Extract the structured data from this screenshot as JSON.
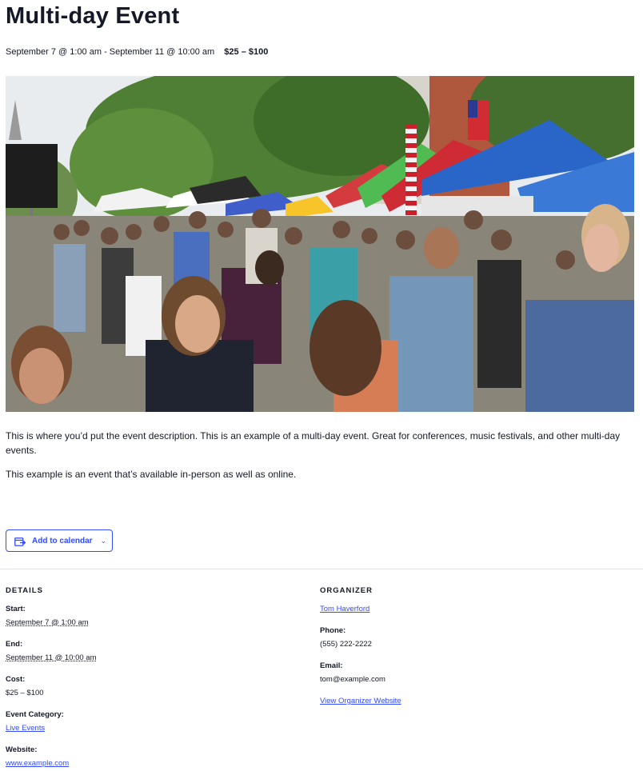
{
  "event": {
    "title": "Multi-day Event",
    "schedule": "September 7 @ 1:00 am - September 11 @ 10:00 am",
    "cost": "$25 – $100",
    "description": [
      "This is where you’d put the event description. This is an example of a multi-day event. Great for conferences, music festivals, and other multi-day events.",
      "This example is an event that’s available in-person as well as online."
    ]
  },
  "calendar_button": {
    "label": "Add to calendar",
    "icon": "calendar-export-icon",
    "chevron": "chevron-down-icon"
  },
  "details": {
    "heading": "DETAILS",
    "start_label": "Start:",
    "start_value": "September 7 @ 1:00 am",
    "end_label": "End:",
    "end_value": "September 11 @ 10:00 am",
    "cost_label": "Cost:",
    "cost_value": "$25 – $100",
    "category_label": "Event Category:",
    "category_value": "Live Events",
    "website_label": "Website:",
    "website_value": "www.example.com"
  },
  "organizer": {
    "heading": "ORGANIZER",
    "name": "Tom Haverford",
    "phone_label": "Phone:",
    "phone_value": "(555) 222-2222",
    "email_label": "Email:",
    "email_value": "tom@example.com",
    "website_link": "View Organizer Website"
  },
  "colors": {
    "accent": "#334aff",
    "text": "#141827",
    "divider": "#e4e4e4"
  }
}
